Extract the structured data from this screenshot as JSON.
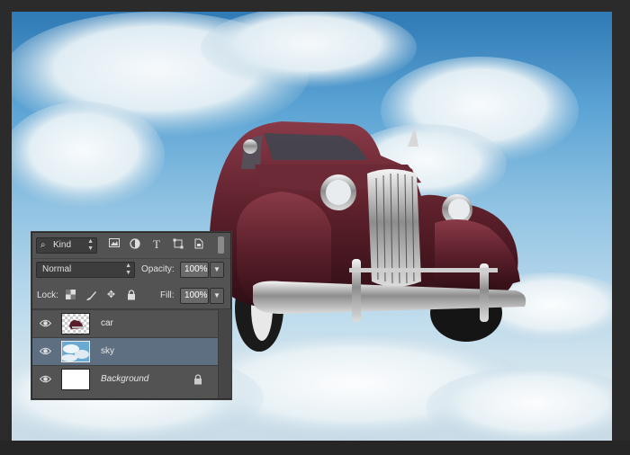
{
  "canvas": {
    "description_layers": [
      "sky",
      "car"
    ]
  },
  "layers_panel": {
    "filter_kind": "Kind",
    "filter_icons": [
      "image-filter-icon",
      "adjustment-filter-icon",
      "type-filter-icon",
      "shape-filter-icon",
      "smart-object-filter-icon"
    ],
    "blend_mode": "Normal",
    "opacity_label": "Opacity:",
    "opacity_value": "100%",
    "lock_label": "Lock:",
    "fill_label": "Fill:",
    "fill_value": "100%",
    "layers": [
      {
        "name": "car",
        "visible": true,
        "selected": false,
        "locked": false
      },
      {
        "name": "sky",
        "visible": true,
        "selected": true,
        "locked": false
      },
      {
        "name": "Background",
        "visible": true,
        "selected": false,
        "locked": true
      }
    ]
  },
  "colors": {
    "panel_bg": "#535353",
    "selected_layer": "#5e6f82",
    "car_body": "#5a1f2a"
  }
}
